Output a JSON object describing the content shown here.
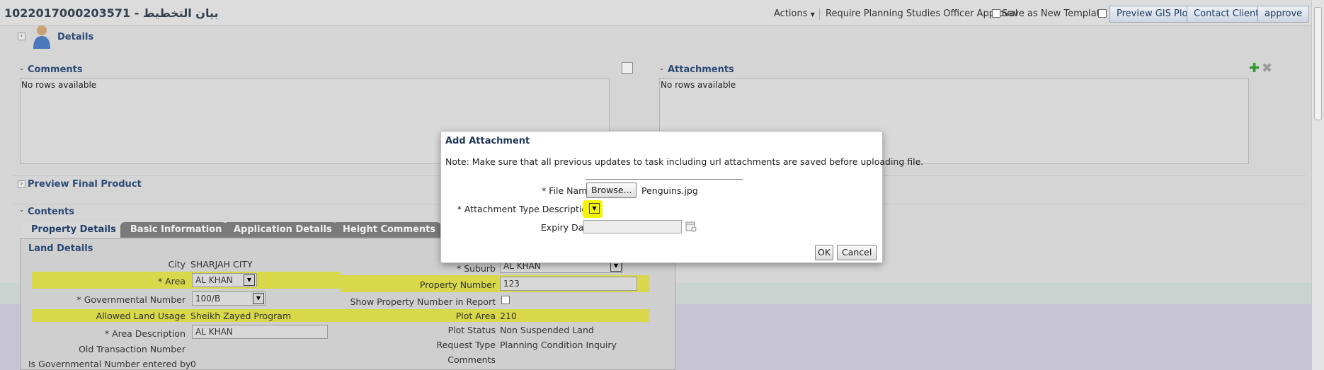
{
  "header": {
    "title": "1022017000203571 - بيان التخطيط",
    "actions_label": "Actions",
    "require_label": "Require Planning Studies Officer Approval",
    "save_template_label": "Save as New Template",
    "preview_gis_label": "Preview GIS Plot",
    "contact_client_label": "Contact Client",
    "approve_label": "approve"
  },
  "details": {
    "label": "Details"
  },
  "comments": {
    "label": "Comments",
    "empty": "No rows available"
  },
  "attachments": {
    "label": "Attachments",
    "empty": "No rows available"
  },
  "preview": {
    "label": "Preview Final Product"
  },
  "contents": {
    "label": "Contents"
  },
  "tabs": [
    {
      "label": "Property Details"
    },
    {
      "label": "Basic Information"
    },
    {
      "label": "Application Details"
    },
    {
      "label": "Height Comments"
    }
  ],
  "land": {
    "label": "Land Details",
    "city_label": "City",
    "city_value": "SHARJAH CITY",
    "area_label": "* Area",
    "area_value": "AL KHAN",
    "gov_label": "* Governmental Number",
    "gov_value": "100/B",
    "allowed_label": "Allowed Land Usage",
    "allowed_value": "Sheikh Zayed Program",
    "areadesc_label": "* Area Description",
    "areadesc_value": "AL KHAN",
    "oldtx_label": "Old Transaction Number",
    "isgov_label": "Is Governmental Number entered by",
    "isgov_value": "0",
    "suburb_label": "* Suburb",
    "suburb_value": "AL KHAN",
    "propnum_label": "Property Number",
    "propnum_value": "123",
    "showprop_label": "Show Property Number in Report",
    "plotarea_label": "Plot Area",
    "plotarea_value": "210",
    "plotstatus_label": "Plot Status",
    "plotstatus_value": "Non Suspended Land",
    "reqtype_label": "Request Type",
    "reqtype_value": "Planning Condition Inquiry",
    "comments_label": "Comments"
  },
  "dialog": {
    "title": "Add Attachment",
    "note": "Note: Make sure that all previous updates to task including url attachments are saved before uploading file.",
    "file_label": "* File Name",
    "browse_label": "Browse...",
    "file_value": "Penguins.jpg",
    "type_label": "* Attachment Type Description",
    "expiry_label": "Expiry Date",
    "ok_label": "OK",
    "cancel_label": "Cancel"
  },
  "colors": {
    "highlight": "#d8d84a",
    "header_text": "#2b4a75",
    "overlay": "#d5d5d5"
  }
}
